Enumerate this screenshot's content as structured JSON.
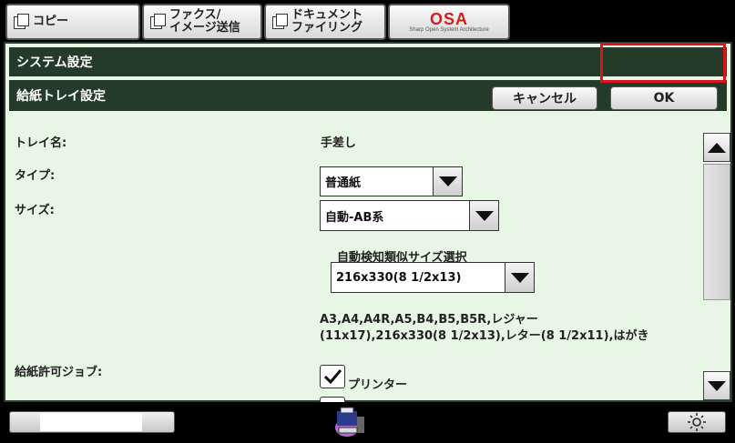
{
  "tabs": [
    {
      "label": "コピー"
    },
    {
      "label": "ファクス/\nイメージ送信"
    },
    {
      "label": "ドキュメント\nファイリング"
    }
  ],
  "osa": {
    "logo": "OSA",
    "sub": "Sharp Open System Architecture"
  },
  "header": {
    "title": "システム設定",
    "subtitle": "給紙トレイ設定"
  },
  "buttons": {
    "cancel": "キャンセル",
    "ok": "OK"
  },
  "form": {
    "tray_name_label": "トレイ名:",
    "tray_name_value": "手差し",
    "type_label": "タイプ:",
    "type_value": "普通紙",
    "size_label": "サイズ:",
    "size_value": "自動-AB系",
    "similar_size_label": "自動検知類似サイズ選択",
    "similar_size_value": "216x330(8 1/2x13)",
    "size_list_line1": "A3,A4,A4R,A5,B4,B5,B5R,レジャー",
    "size_list_line2": "(11x17),216x330(8 1/2x13),レター(8 1/2x11),はがき",
    "jobs_label": "給紙許可ジョブ:",
    "jobs": [
      {
        "label": "プリンター",
        "checked": true
      }
    ]
  },
  "colors": {
    "header_bg": "#243b2a",
    "panel_bg": "#e8f6e6",
    "ok_highlight": "#d8141c"
  }
}
